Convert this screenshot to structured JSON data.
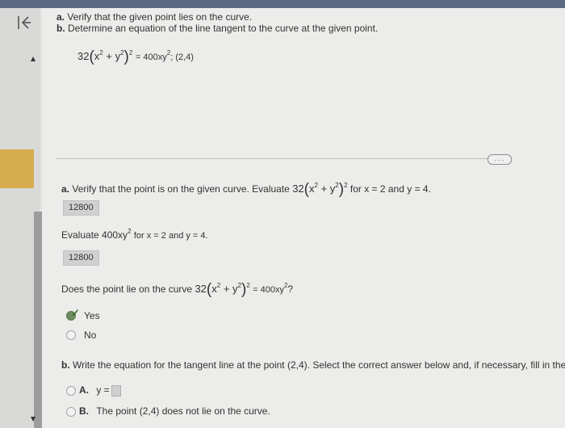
{
  "instructions": {
    "a_label": "a.",
    "a_text": "Verify that the given point lies on the curve.",
    "b_label": "b.",
    "b_text": "Determine an equation of the line tangent to the curve at the given point."
  },
  "given_equation": {
    "coef": "32",
    "base": "x",
    "base2": "y",
    "exp": "2",
    "outer_exp": "2",
    "rhs": "= 400xy",
    "rhs_exp": "2",
    "point": "; (2,4)"
  },
  "part_a": {
    "label": "a.",
    "text": "Verify that the point is on the given curve. Evaluate",
    "for_text": "for x = 2 and y = 4.",
    "answer1": "12800",
    "eval2_prefix": "Evaluate 400xy",
    "eval2_exp": "2",
    "eval2_suffix": "for x = 2 and y = 4.",
    "answer2": "12800",
    "question_prefix": "Does the point lie on the curve",
    "question_suffix": "= 400xy",
    "question_exp": "2",
    "question_mark": "?",
    "options": [
      "Yes",
      "No"
    ],
    "selected": "Yes"
  },
  "part_b": {
    "label": "b.",
    "text": "Write the equation for the tangent line at the point (2,4). Select the correct answer below and, if necessary, fill in the ans",
    "option_a_label": "A.",
    "option_a_text": "y =",
    "option_b_label": "B.",
    "option_b_text": "The point (2,4) does not lie on the curve."
  },
  "more_button_label": "....",
  "collapse_icon": "collapse-left-icon"
}
